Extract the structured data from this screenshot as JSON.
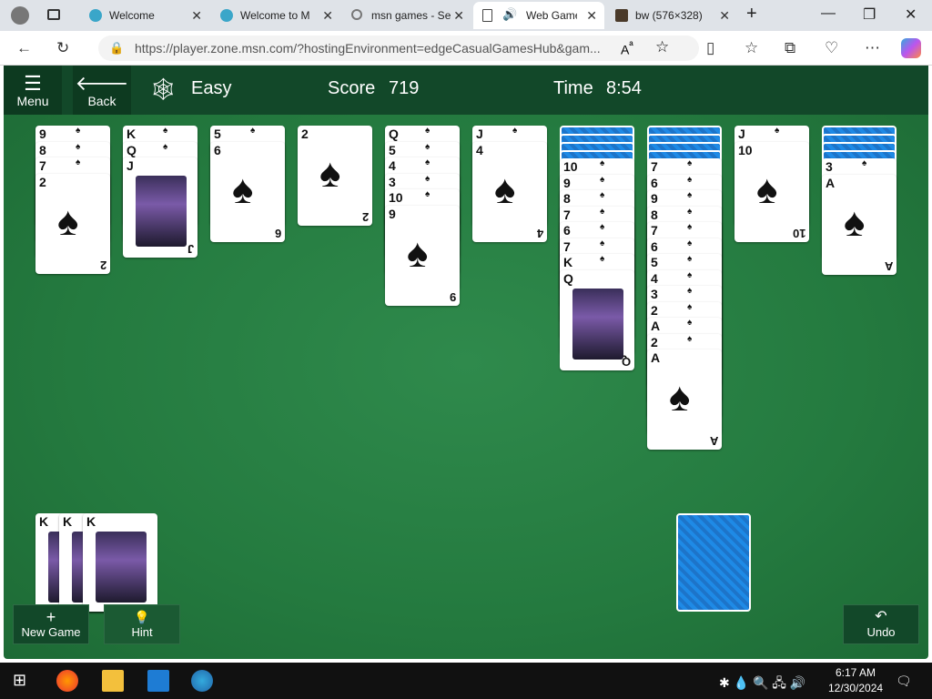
{
  "browser": {
    "tabs": [
      {
        "title": "Welcome",
        "active": false
      },
      {
        "title": "Welcome to M",
        "active": false
      },
      {
        "title": "msn games - Se",
        "active": false
      },
      {
        "title": "Web Game",
        "active": true
      },
      {
        "title": "bw (576×328)",
        "active": false
      }
    ],
    "url": "https://player.zone.msn.com/?hostingEnvironment=edgeCasualGamesHub&gam..."
  },
  "game": {
    "menu_label": "Menu",
    "back_label": "Back",
    "difficulty": "Easy",
    "score_label": "Score",
    "score_value": "719",
    "time_label": "Time",
    "time_value": "8:54",
    "new_game_label": "New Game",
    "hint_label": "Hint",
    "undo_label": "Undo",
    "columns": [
      {
        "faceup": [
          "9",
          "8",
          "7",
          "2"
        ],
        "facedown": 0
      },
      {
        "faceup": [
          "K",
          "Q",
          "J"
        ],
        "facedown": 0
      },
      {
        "faceup": [
          "5",
          "6"
        ],
        "facedown": 0
      },
      {
        "faceup": [
          "2"
        ],
        "facedown": 0
      },
      {
        "faceup": [
          "Q",
          "5",
          "4",
          "3",
          "10",
          "9"
        ],
        "facedown": 0
      },
      {
        "faceup": [
          "J",
          "4"
        ],
        "facedown": 0
      },
      {
        "faceup": [
          "10",
          "9",
          "8",
          "7",
          "6",
          "7",
          "K",
          "Q"
        ],
        "facedown": 4
      },
      {
        "faceup": [
          "7",
          "6",
          "9",
          "8",
          "7",
          "6",
          "5",
          "4",
          "3",
          "2",
          "A",
          "2",
          "A"
        ],
        "facedown": 4
      },
      {
        "faceup": [
          "J",
          "10"
        ],
        "facedown": 0
      },
      {
        "faceup": [
          "3",
          "A"
        ],
        "facedown": 4
      }
    ],
    "foundations": [
      "K",
      "K",
      "K"
    ]
  },
  "taskbar": {
    "time": "6:17 AM",
    "date": "12/30/2024"
  }
}
